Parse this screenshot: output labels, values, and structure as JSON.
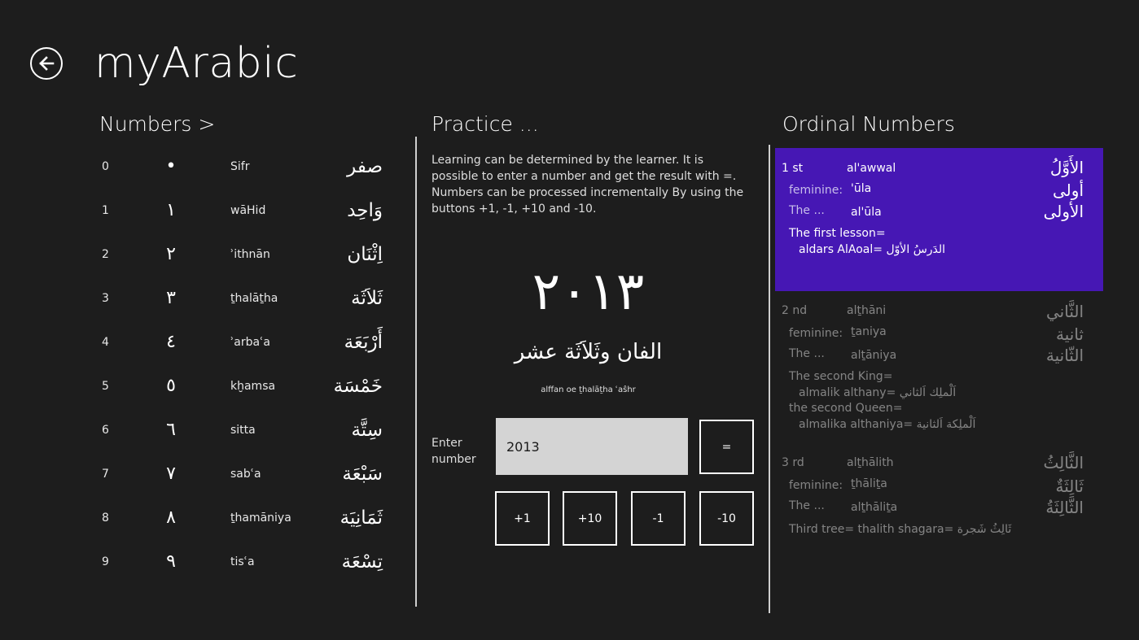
{
  "app": {
    "title": "myArabic"
  },
  "numbers": {
    "title": "Numbers >",
    "rows": [
      {
        "digit": "0",
        "arabic_digit": "•",
        "translit": "Sifr",
        "word": "صفر"
      },
      {
        "digit": "1",
        "arabic_digit": "١",
        "translit": "wāHid",
        "word": "وَاحِد"
      },
      {
        "digit": "2",
        "arabic_digit": "٢",
        "translit": "ʾithnān",
        "word": "اِثْنَان"
      },
      {
        "digit": "3",
        "arabic_digit": "٣",
        "translit": "ṯhalāṯha",
        "word": "ثَلاَثَة"
      },
      {
        "digit": "4",
        "arabic_digit": "٤",
        "translit": "ʾarbaʿa",
        "word": "أَرْبَعَة"
      },
      {
        "digit": "5",
        "arabic_digit": "٥",
        "translit": "kḫamsa",
        "word": "خَمْسَة"
      },
      {
        "digit": "6",
        "arabic_digit": "٦",
        "translit": "sitta",
        "word": "سِتَّة"
      },
      {
        "digit": "7",
        "arabic_digit": "٧",
        "translit": "sabʿa",
        "word": "سَبْعَة"
      },
      {
        "digit": "8",
        "arabic_digit": "٨",
        "translit": "ṯhamāniya",
        "word": "ثَمَانِيَة"
      },
      {
        "digit": "9",
        "arabic_digit": "٩",
        "translit": "tisʿa",
        "word": "تِسْعَة"
      }
    ]
  },
  "practice": {
    "title": "Practice ...",
    "description": "Learning can be determined by the learner. It is possible to enter a number and get the result  with =. Numbers can be processed incrementally By using the buttons +1, -1, +10 and -10.",
    "result_number": "٢٠١٣",
    "result_words": "الفان  وثَلاَثَة عشر",
    "result_translit": "alffan  oe ṯhalāṯha  ʿaŝhr",
    "enter_label": "Enter number",
    "input_value": "2013",
    "equals_label": "=",
    "buttons": [
      "+1",
      "+10",
      "-1",
      "-10"
    ]
  },
  "ordinals": {
    "title": "Ordinal Numbers",
    "feminine_label": "feminine:",
    "the_label": "The ...",
    "items": [
      {
        "num": "1 st",
        "translit": "al'awwal",
        "arabic": "الأَوَّلُ",
        "fem_translit": "'ūla",
        "fem_arabic": "أولى",
        "the_translit": "al'ūla",
        "the_arabic": "الأولى",
        "example_lines": [
          "The first lesson=",
          "aldars AlAoal= الدَرسُ الأوّل"
        ]
      },
      {
        "num": "2 nd",
        "translit": "alṯhāni",
        "arabic": "الثَّاني",
        "fem_translit": "ṯaniya",
        "fem_arabic": "ثانية",
        "the_translit": "alṯāniya",
        "the_arabic": "الثّانية",
        "example_lines": [
          "The second King=",
          "almalik althany= اَلْملِك اَلثاني",
          "the second Queen=",
          "almalika althaniya= اَلْملِكة اَلثانية"
        ]
      },
      {
        "num": "3 rd",
        "translit": "alṯhālith",
        "arabic": "الثَّالِثُ",
        "fem_translit": "ṯhāliṯa",
        "fem_arabic": "ثَالِثَةٌ",
        "the_translit": "alṯhāliṯa",
        "the_arabic": "الثَّالِثَةُ",
        "example_lines": [
          "Third tree= thalith shagara= ثَالِثُ شَجرة"
        ]
      }
    ]
  },
  "colors": {
    "background": "#1d1d1d",
    "accent": "#4617b4",
    "input_bg": "#d4d4d4"
  },
  "icons": {
    "back": "back-arrow-icon"
  }
}
